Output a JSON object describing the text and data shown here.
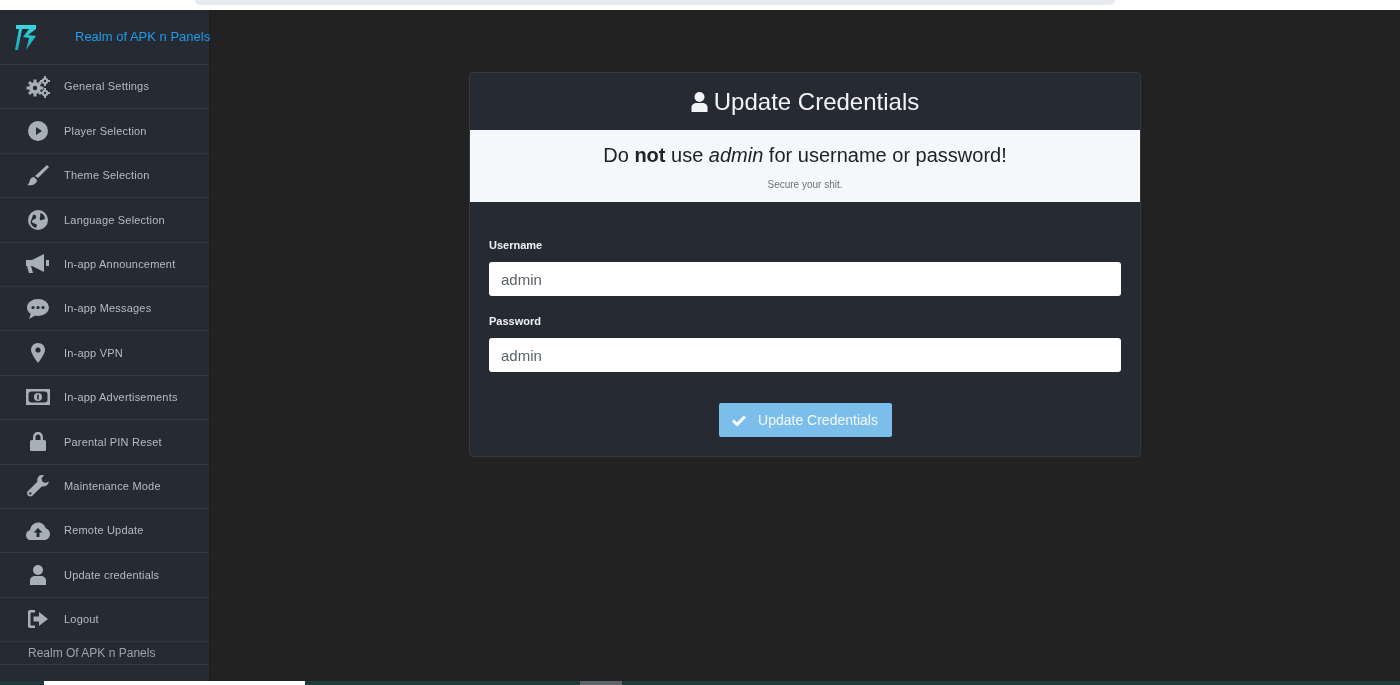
{
  "sidebar": {
    "brand": "Realm of APK n Panels",
    "items": [
      {
        "label": "General Settings"
      },
      {
        "label": "Player Selection"
      },
      {
        "label": "Theme Selection"
      },
      {
        "label": "Language Selection"
      },
      {
        "label": "In-app Announcement"
      },
      {
        "label": "In-app Messages"
      },
      {
        "label": "In-app VPN"
      },
      {
        "label": "In-app Advertisements"
      },
      {
        "label": "Parental PIN Reset"
      },
      {
        "label": "Maintenance Mode"
      },
      {
        "label": "Remote Update"
      },
      {
        "label": "Update credentials"
      },
      {
        "label": "Logout"
      }
    ],
    "footer": "Realm Of APK n Panels"
  },
  "card": {
    "title": "Update Credentials",
    "notice": {
      "message": "Do **not** use *admin* for username or password!",
      "note": "Secure your shit."
    },
    "fields": [
      {
        "label": "Username",
        "value": "admin"
      },
      {
        "label": "Password",
        "value": "admin"
      }
    ],
    "submit": "Update Credentials"
  }
}
